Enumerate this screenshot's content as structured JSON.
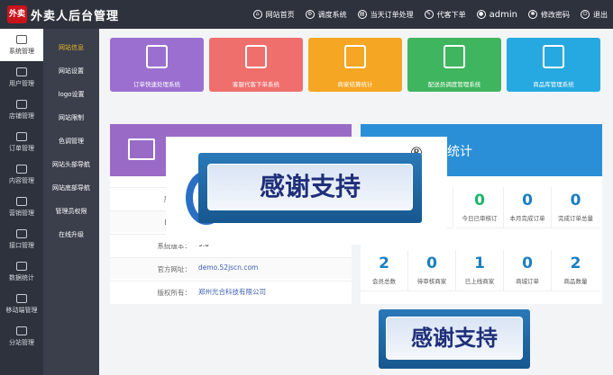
{
  "header": {
    "logo_text": "外卖",
    "title": "外卖人后台管理",
    "nav": [
      {
        "label": "网站首页",
        "icon": "home-icon"
      },
      {
        "label": "调度系统",
        "icon": "dispatch-icon"
      },
      {
        "label": "当天订单处理",
        "icon": "order-icon"
      },
      {
        "label": "代客下单",
        "icon": "proxy-order-icon"
      }
    ],
    "user": "admin",
    "change_password": "修改密码",
    "logout": "退出"
  },
  "sidebar": {
    "items": [
      {
        "label": "系统管理",
        "active": true
      },
      {
        "label": "用户管理"
      },
      {
        "label": "店铺管理"
      },
      {
        "label": "订单管理"
      },
      {
        "label": "内容管理"
      },
      {
        "label": "营销管理"
      },
      {
        "label": "接口管理"
      },
      {
        "label": "数据统计"
      },
      {
        "label": "移动端管理"
      },
      {
        "label": "分站管理"
      }
    ]
  },
  "subnav": {
    "items": [
      {
        "label": "网站信息",
        "active": true
      },
      {
        "label": "网站设置"
      },
      {
        "label": "logo设置"
      },
      {
        "label": "网站限制"
      },
      {
        "label": "色调管理"
      },
      {
        "label": "网站头部导航"
      },
      {
        "label": "网站底部导航"
      },
      {
        "label": "管理员权限"
      },
      {
        "label": "在线升级"
      }
    ]
  },
  "tiles": [
    {
      "label": "订单快速处理系统",
      "color": "#9b6fd0"
    },
    {
      "label": "客服代客下单系统",
      "color": "#ef6f6c"
    },
    {
      "label": "商家结算统计",
      "color": "#f5a623"
    },
    {
      "label": "配送员调度管理系统",
      "color": "#3fb55f"
    },
    {
      "label": "商品库管理系统",
      "color": "#26a9e0"
    }
  ],
  "system_info": {
    "rows": [
      {
        "key": "服务器时",
        "value": ""
      },
      {
        "key": "PHP版本",
        "value": ""
      },
      {
        "key": "系统版本：",
        "value": "9.0"
      },
      {
        "key": "官方网址：",
        "value": "demo.52jscn.com"
      },
      {
        "key": "版权所有：",
        "value": "郑州光合科技有限公司"
      }
    ]
  },
  "stats": {
    "title_fragment": "统计",
    "row1": [
      {
        "value": "",
        "label": "订"
      },
      {
        "value": "0",
        "label": "今日已审核订"
      },
      {
        "value": "0",
        "label": "本月完成订单"
      },
      {
        "value": "0",
        "label": "完成订单总量"
      }
    ],
    "row2": [
      {
        "value": "2",
        "label": "会员总数"
      },
      {
        "value": "0",
        "label": "待审核商家"
      },
      {
        "value": "1",
        "label": "已上线商家"
      },
      {
        "value": "0",
        "label": "商城订单"
      },
      {
        "value": "2",
        "label": "商品数量"
      }
    ]
  },
  "overlay": {
    "banner_text": "感谢支持",
    "registered_mark": "®"
  },
  "colors": {
    "topbar": "#2d323d",
    "info_header": "#9a6bc6",
    "stats_header": "#2a8fd6",
    "accent_link": "#3d5fb3"
  }
}
